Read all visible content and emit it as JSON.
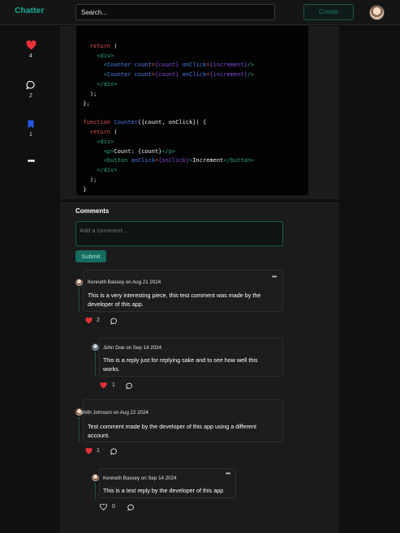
{
  "header": {
    "logo": "Chatter",
    "search_placeholder": "Search...",
    "create_label": "Create"
  },
  "rail": {
    "likes": "4",
    "comments": "2",
    "bookmarks": "1"
  },
  "code_lines": [
    [
      {
        "c": "w",
        "t": ""
      }
    ],
    [
      {
        "c": "k",
        "t": "    return "
      },
      {
        "c": "w",
        "t": "("
      }
    ],
    [
      {
        "c": "t",
        "t": "      <div>"
      }
    ],
    [
      {
        "c": "w",
        "t": "        "
      },
      {
        "c": "t",
        "t": "<"
      },
      {
        "c": "c",
        "t": "Counter "
      },
      {
        "c": "c",
        "t": "count"
      },
      {
        "c": "k",
        "t": "="
      },
      {
        "c": "a",
        "t": "{count}"
      },
      {
        "c": "c",
        "t": " onClick"
      },
      {
        "c": "k",
        "t": "="
      },
      {
        "c": "a",
        "t": "{increment}"
      },
      {
        "c": "t",
        "t": "/>"
      }
    ],
    [
      {
        "c": "w",
        "t": "        "
      },
      {
        "c": "t",
        "t": "<"
      },
      {
        "c": "c",
        "t": "Counter "
      },
      {
        "c": "c",
        "t": "count"
      },
      {
        "c": "k",
        "t": "="
      },
      {
        "c": "a",
        "t": "{count}"
      },
      {
        "c": "c",
        "t": " onClick"
      },
      {
        "c": "k",
        "t": "="
      },
      {
        "c": "a",
        "t": "{increment}"
      },
      {
        "c": "t",
        "t": "/>"
      }
    ],
    [
      {
        "c": "t",
        "t": "      </div>"
      }
    ],
    [
      {
        "c": "w",
        "t": "    );"
      }
    ],
    [
      {
        "c": "w",
        "t": "  };"
      }
    ],
    [
      {
        "c": "w",
        "t": ""
      }
    ],
    [
      {
        "c": "k",
        "t": "  function "
      },
      {
        "c": "c",
        "t": "Counter"
      },
      {
        "c": "w",
        "t": "({count, onClick}) {"
      }
    ],
    [
      {
        "c": "k",
        "t": "    return "
      },
      {
        "c": "w",
        "t": "("
      }
    ],
    [
      {
        "c": "t",
        "t": "      <div>"
      }
    ],
    [
      {
        "c": "w",
        "t": "        "
      },
      {
        "c": "t",
        "t": "<p>"
      },
      {
        "c": "w",
        "t": "Count: {count}"
      },
      {
        "c": "t",
        "t": "</p>"
      }
    ],
    [
      {
        "c": "w",
        "t": "        "
      },
      {
        "c": "t",
        "t": "<button "
      },
      {
        "c": "c",
        "t": "onClick"
      },
      {
        "c": "k",
        "t": "="
      },
      {
        "c": "a",
        "t": "{onClick}"
      },
      {
        "c": "t",
        "t": ">"
      },
      {
        "c": "w",
        "t": "Increment"
      },
      {
        "c": "t",
        "t": "</button>"
      }
    ],
    [
      {
        "c": "t",
        "t": "      </div>"
      }
    ],
    [
      {
        "c": "w",
        "t": "    );"
      }
    ],
    [
      {
        "c": "w",
        "t": "  }"
      }
    ]
  ],
  "comments_section": {
    "title": "Comments",
    "input_placeholder": "Add a comment...",
    "submit_label": "Submit"
  },
  "comments": [
    {
      "author_line": "Kenneth Bassey on Aug 21 2024",
      "text_1": "This is a very interesting piece, this test comment was made by the",
      "text_2": "developer of this app.",
      "likes": "2"
    },
    {
      "author_line": "John Doe on Sep 14 2024",
      "text_1": "This is a reply just for replying sake and to see how well this",
      "text_2": "works.",
      "likes": "1"
    },
    {
      "author_line": "Smith Johnson on Aug 22 2024",
      "text_1": "Test comment made by the developer of this app using a different",
      "text_2": "account.",
      "likes": "1"
    },
    {
      "author_line": "Kenneth Bassey on Sep 14 2024",
      "text_1": "This is a test reply by the developer of this app",
      "likes": "0"
    }
  ],
  "colors": {
    "accent": "#1e9a86",
    "like_red": "#e8303a",
    "bookmark_blue": "#2456e6"
  }
}
